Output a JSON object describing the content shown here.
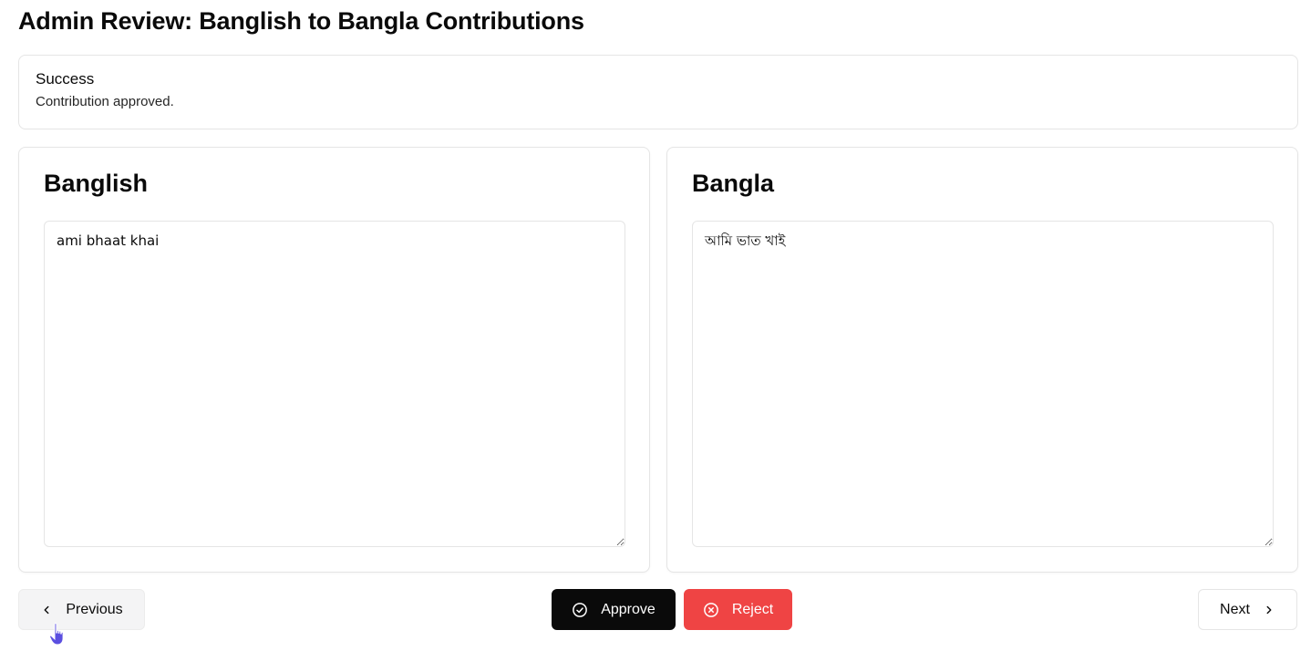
{
  "page": {
    "title": "Admin Review: Banglish to Bangla Contributions"
  },
  "alert": {
    "title": "Success",
    "description": "Contribution approved."
  },
  "banglish_card": {
    "title": "Banglish",
    "text": "ami bhaat khai"
  },
  "bangla_card": {
    "title": "Bangla",
    "text": "আমি ভাত খাই"
  },
  "footer": {
    "previous_label": "Previous",
    "approve_label": "Approve",
    "reject_label": "Reject",
    "next_label": "Next"
  },
  "icons": {
    "previous": "chevron-left-icon",
    "approve": "check-circle-icon",
    "reject": "x-circle-icon",
    "next": "chevron-right-icon",
    "cursor": "hand-pointer-icon"
  },
  "colors": {
    "approve_bg": "#0a0a0a",
    "reject_bg": "#ef4444",
    "cursor": "#5b4fe0"
  }
}
